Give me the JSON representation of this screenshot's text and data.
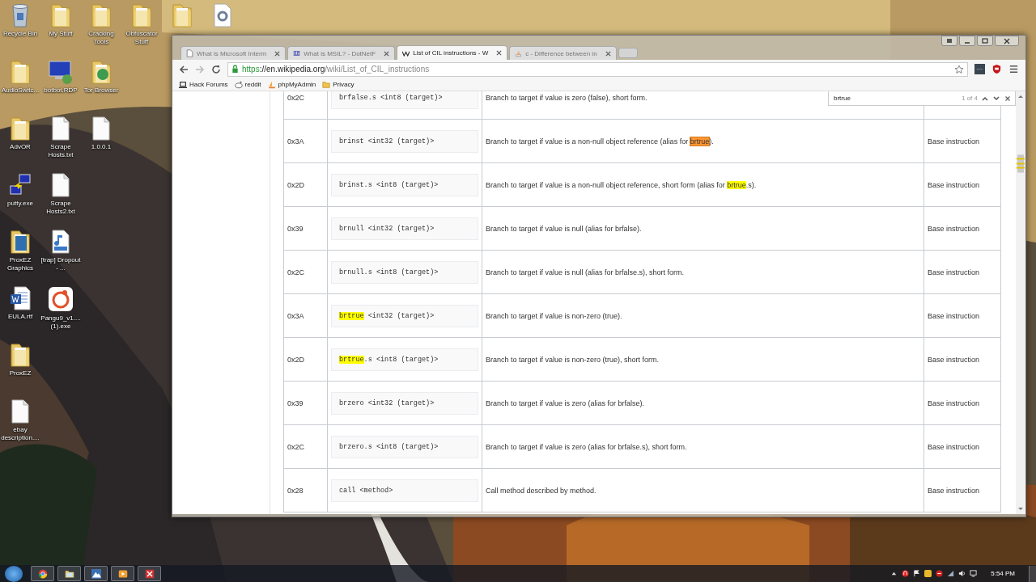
{
  "desktop_rows": [
    [
      {
        "label": "Recycle Bin",
        "kind": "recycle"
      },
      {
        "label": "My Stuff",
        "kind": "folder"
      },
      {
        "label": "Cracking Tools",
        "kind": "folder"
      },
      {
        "label": "Obfuscator Stuff",
        "kind": "folder"
      },
      {
        "kind": "folder"
      },
      {
        "kind": "settings-file"
      }
    ],
    [
      {
        "label": "AudioSwitc...",
        "kind": "folder"
      },
      {
        "label": "botbot.RDP",
        "kind": "remote"
      },
      {
        "label": "Tor Browser",
        "kind": "globe-folder"
      }
    ],
    [
      {
        "label": "AdvOR",
        "kind": "folder"
      },
      {
        "label": "Scrape Hosts.txt",
        "kind": "file"
      },
      {
        "label": "1.0.0.1",
        "kind": "file"
      }
    ],
    [
      {
        "label": "putty.exe",
        "kind": "network"
      },
      {
        "label": "Scrape Hosts2.txt",
        "kind": "file"
      }
    ],
    [
      {
        "label": "ProxEZ Graphics",
        "kind": "blue-folder"
      },
      {
        "label": "[trap] Dropout - ...",
        "kind": "audio"
      }
    ],
    [
      {
        "label": "EULA.rtf",
        "kind": "document"
      },
      {
        "label": "Pangu9_v1.... (1).exe",
        "kind": "app"
      }
    ],
    [
      {
        "label": "ProxEZ",
        "kind": "folder"
      }
    ],
    [
      {
        "label": "ebay description....",
        "kind": "file"
      }
    ]
  ],
  "browser": {
    "tabs": [
      {
        "title": "What is Microsoft Interm",
        "selected": false,
        "kind": "page"
      },
      {
        "title": "What is MSIL? - DotNetF",
        "selected": false,
        "kind": "site"
      },
      {
        "title": "List of CIL instructions - W",
        "selected": true,
        "kind": "wiki"
      },
      {
        "title": "c - Difference between in",
        "selected": false,
        "kind": "stack"
      }
    ],
    "url": {
      "scheme": "https",
      "host": "://en.wikipedia.org",
      "path": "/wiki/List_of_CIL_instructions"
    },
    "bookmarks": [
      {
        "label": "Hack Forums",
        "kind": "laptop"
      },
      {
        "label": "reddit",
        "kind": "alien"
      },
      {
        "label": "phpMyAdmin",
        "kind": "sail"
      },
      {
        "label": "Privacy",
        "kind": "folder"
      }
    ],
    "find_bar": {
      "value": "brtrue",
      "count": "1 of 4"
    }
  },
  "table": {
    "rows": [
      {
        "opcode": "0x2C",
        "instruction": [
          {
            "text": "brfalse.s <int8 (target)>",
            "highlighted": false,
            "selected": false
          }
        ],
        "description": [
          {
            "text": "Branch to target if value is zero (false), short form.",
            "highlighted": false,
            "selected": false
          }
        ]
      },
      {
        "opcode": "0x3A",
        "instruction": [
          {
            "text": "brinst <int32 (target)>",
            "highlighted": false,
            "selected": false
          }
        ],
        "description": [
          {
            "text": "Branch to target if value is a non-null object reference (alias for ",
            "highlighted": false,
            "selected": false
          },
          {
            "text": "brtrue",
            "highlighted": true,
            "selected": true
          },
          {
            "text": ").",
            "highlighted": false,
            "selected": false
          }
        ],
        "category": "Base instruction"
      },
      {
        "opcode": "0x2D",
        "instruction": [
          {
            "text": "brinst.s <int8 (target)>",
            "highlighted": false,
            "selected": false
          }
        ],
        "description": [
          {
            "text": "Branch to target if value is a non-null object reference, short form (alias for ",
            "highlighted": false,
            "selected": false
          },
          {
            "text": "brtrue",
            "highlighted": true,
            "selected": false
          },
          {
            "text": ".s).",
            "highlighted": false,
            "selected": false
          }
        ],
        "category": "Base instruction"
      },
      {
        "opcode": "0x39",
        "instruction": [
          {
            "text": "brnull <int32 (target)>",
            "highlighted": false,
            "selected": false
          }
        ],
        "description": [
          {
            "text": "Branch to target if value is null (alias for brfalse).",
            "highlighted": false,
            "selected": false
          }
        ],
        "category": "Base instruction"
      },
      {
        "opcode": "0x2C",
        "instruction": [
          {
            "text": "brnull.s <int8 (target)>",
            "highlighted": false,
            "selected": false
          }
        ],
        "description": [
          {
            "text": "Branch to target if value is null (alias for brfalse.s), short form.",
            "highlighted": false,
            "selected": false
          }
        ],
        "category": "Base instruction"
      },
      {
        "opcode": "0x3A",
        "instruction": [
          {
            "text": "brtrue",
            "highlighted": true,
            "selected": false
          },
          {
            "text": " <int32 (target)>",
            "highlighted": false,
            "selected": false
          }
        ],
        "description": [
          {
            "text": "Branch to target if value is non-zero (true).",
            "highlighted": false,
            "selected": false
          }
        ],
        "category": "Base instruction"
      },
      {
        "opcode": "0x2D",
        "instruction": [
          {
            "text": "brtrue",
            "highlighted": true,
            "selected": false
          },
          {
            "text": ".s <int8 (target)>",
            "highlighted": false,
            "selected": false
          }
        ],
        "description": [
          {
            "text": "Branch to target if value is non-zero (true), short form.",
            "highlighted": false,
            "selected": false
          }
        ],
        "category": "Base instruction"
      },
      {
        "opcode": "0x39",
        "instruction": [
          {
            "text": "brzero <int32 (target)>",
            "highlighted": false,
            "selected": false
          }
        ],
        "description": [
          {
            "text": "Branch to target if value is zero (alias for brfalse).",
            "highlighted": false,
            "selected": false
          }
        ],
        "category": "Base instruction"
      },
      {
        "opcode": "0x2C",
        "instruction": [
          {
            "text": "brzero.s <int8 (target)>",
            "highlighted": false,
            "selected": false
          }
        ],
        "description": [
          {
            "text": "Branch to target if value is zero (alias for brfalse.s), short form.",
            "highlighted": false,
            "selected": false
          }
        ],
        "category": "Base instruction"
      },
      {
        "opcode": "0x28",
        "instruction": [
          {
            "text": "call <method>",
            "highlighted": false,
            "selected": false
          }
        ],
        "description": [
          {
            "text": "Call method described by method.",
            "highlighted": false,
            "selected": false
          }
        ],
        "category": "Base instruction"
      }
    ]
  },
  "taskbar": {
    "apps": [
      {
        "kind": "browser"
      },
      {
        "kind": "folder"
      },
      {
        "kind": "mountain"
      },
      {
        "kind": "media"
      },
      {
        "kind": "close-app"
      }
    ],
    "clock": "5:54 PM"
  }
}
